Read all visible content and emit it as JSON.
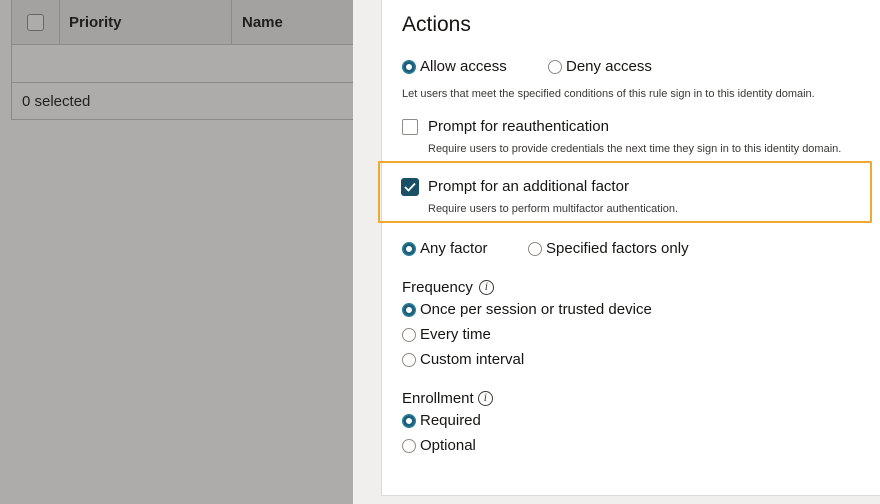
{
  "background_table": {
    "columns": [
      "Priority",
      "Name"
    ],
    "selected_count": "0 selected"
  },
  "actions": {
    "title": "Actions",
    "access": {
      "options": [
        {
          "label": "Allow access",
          "selected": true
        },
        {
          "label": "Deny access",
          "selected": false
        }
      ],
      "help": "Let users that meet the specified conditions of this rule sign in to this identity domain."
    },
    "reauth": {
      "label": "Prompt for reauthentication",
      "checked": false,
      "help": "Require users to provide credentials the next time they sign in to this identity domain."
    },
    "additional_factor": {
      "label": "Prompt for an additional factor",
      "checked": true,
      "help": "Require users to perform multifactor authentication."
    },
    "factor_scope": {
      "options": [
        {
          "label": "Any factor",
          "selected": true
        },
        {
          "label": "Specified factors only",
          "selected": false
        }
      ]
    },
    "frequency": {
      "label": "Frequency",
      "info_icon": "i",
      "options": [
        {
          "label": "Once per session or trusted device",
          "selected": true
        },
        {
          "label": "Every time",
          "selected": false
        },
        {
          "label": "Custom interval",
          "selected": false
        }
      ]
    },
    "enrollment": {
      "label": "Enrollment",
      "info_icon": "i",
      "options": [
        {
          "label": "Required",
          "selected": true
        },
        {
          "label": "Optional",
          "selected": false
        }
      ]
    }
  },
  "colors": {
    "accent": "#1b5f7a",
    "highlight": "#f0a830"
  }
}
